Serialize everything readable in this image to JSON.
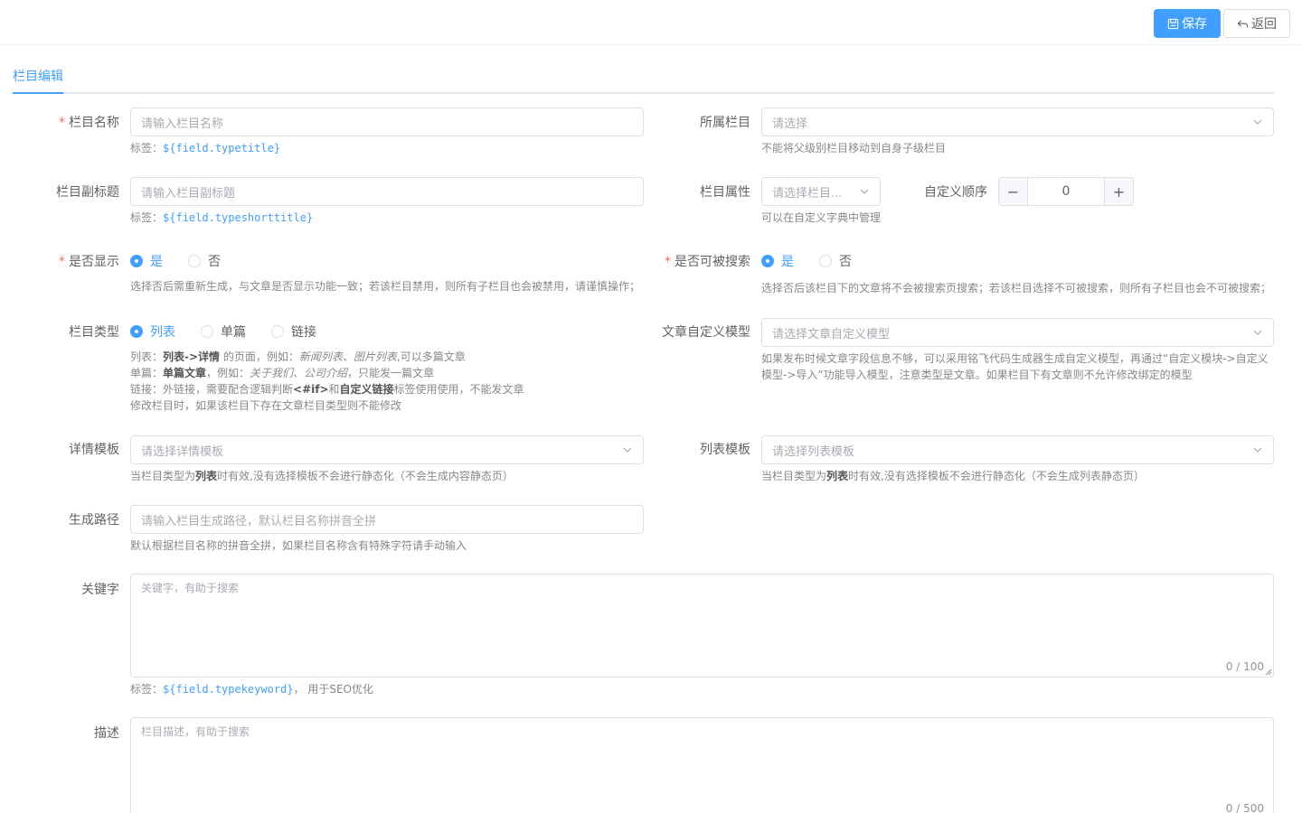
{
  "toolbar": {
    "save_label": "保存",
    "back_label": "返回"
  },
  "tabs": {
    "active": "栏目编辑"
  },
  "fields": {
    "name": {
      "label": "栏目名称",
      "placeholder": "请输入栏目名称",
      "tip_prefix": "标签：",
      "tip_code": "${field.typetitle}"
    },
    "parent": {
      "label": "所属栏目",
      "placeholder": "请选择",
      "tip": "不能将父级别栏目移动到自身子级栏目"
    },
    "subtitle": {
      "label": "栏目副标题",
      "placeholder": "请输入栏目副标题",
      "tip_prefix": "标签：",
      "tip_code": "${field.typeshorttitle}"
    },
    "attr": {
      "label": "栏目属性",
      "placeholder": "请选择栏目...",
      "tip": "可以在自定义字典中管理"
    },
    "order": {
      "label": "自定义顺序",
      "value": "0",
      "minus": "−",
      "plus": "+"
    },
    "show": {
      "label": "是否显示",
      "options": [
        "是",
        "否"
      ],
      "selected": "是",
      "tip": "选择否后需重新生成，与文章是否显示功能一致；若该栏目禁用，则所有子栏目也会被禁用，请谨慎操作；"
    },
    "searchable": {
      "label": "是否可被搜索",
      "options": [
        "是",
        "否"
      ],
      "selected": "是",
      "tip": "选择否后该栏目下的文章将不会被搜索页搜索；若该栏目选择不可被搜索，则所有子栏目也会不可被搜索；"
    },
    "type": {
      "label": "栏目类型",
      "options": [
        "列表",
        "单篇",
        "链接"
      ],
      "selected": "列表",
      "tip1": {
        "a": "列表：",
        "b": "列表->详情",
        "c": " 的页面，例如：",
        "d": "新闻列表、图片列表",
        "e": ",可以多篇文章"
      },
      "tip2": {
        "a": "单篇：",
        "b": "单篇文章",
        "c": "，例如：",
        "d": "关于我们、公司介绍",
        "e": "，只能发一篇文章"
      },
      "tip3": {
        "a": "链接：外链接，需要配合逻辑判断",
        "b": "<#if>",
        "c": "和",
        "d": "自定义链接",
        "e": "标签使用使用，不能发文章"
      },
      "tip4": "修改栏目时，如果该栏目下存在文章栏目类型则不能修改"
    },
    "model": {
      "label": "文章自定义模型",
      "placeholder": "请选择文章自定义模型",
      "tip1": "如果发布时候文章字段信息不够，可以采用铭飞代码生成器生成自定义模型，再通过“自定义模块->自定义",
      "tip2": "模型->导入”功能导入模型，注意类型是文章。如果栏目下有文章则不允许修改绑定的模型"
    },
    "detail_tpl": {
      "label": "详情模板",
      "placeholder": "请选择详情模板",
      "tip_a": "当栏目类型为",
      "tip_b": "列表",
      "tip_c": "时有效,没有选择模板不会进行静态化（不会生成内容静态页）"
    },
    "list_tpl": {
      "label": "列表模板",
      "placeholder": "请选择列表模板",
      "tip_a": "当栏目类型为",
      "tip_b": "列表",
      "tip_c": "时有效,没有选择模板不会进行静态化（不会生成列表静态页）"
    },
    "path": {
      "label": "生成路径",
      "placeholder": "请输入栏目生成路径，默认栏目名称拼音全拼",
      "tip": "默认根据栏目名称的拼音全拼，如果栏目名称含有特殊字符请手动输入"
    },
    "keyword": {
      "label": "关键字",
      "placeholder": "关键字，有助于搜索",
      "count": "0 / 100",
      "tip_prefix": "标签：",
      "tip_code": "${field.typekeyword}",
      "tip_suffix": "， 用于SEO优化"
    },
    "desc": {
      "label": "描述",
      "placeholder": "栏目描述，有助于搜索",
      "count": "0 / 500"
    }
  },
  "required_mark": "*",
  "colors": {
    "primary": "#409eff",
    "required": "#f56c6c",
    "border": "#dcdfe6"
  }
}
